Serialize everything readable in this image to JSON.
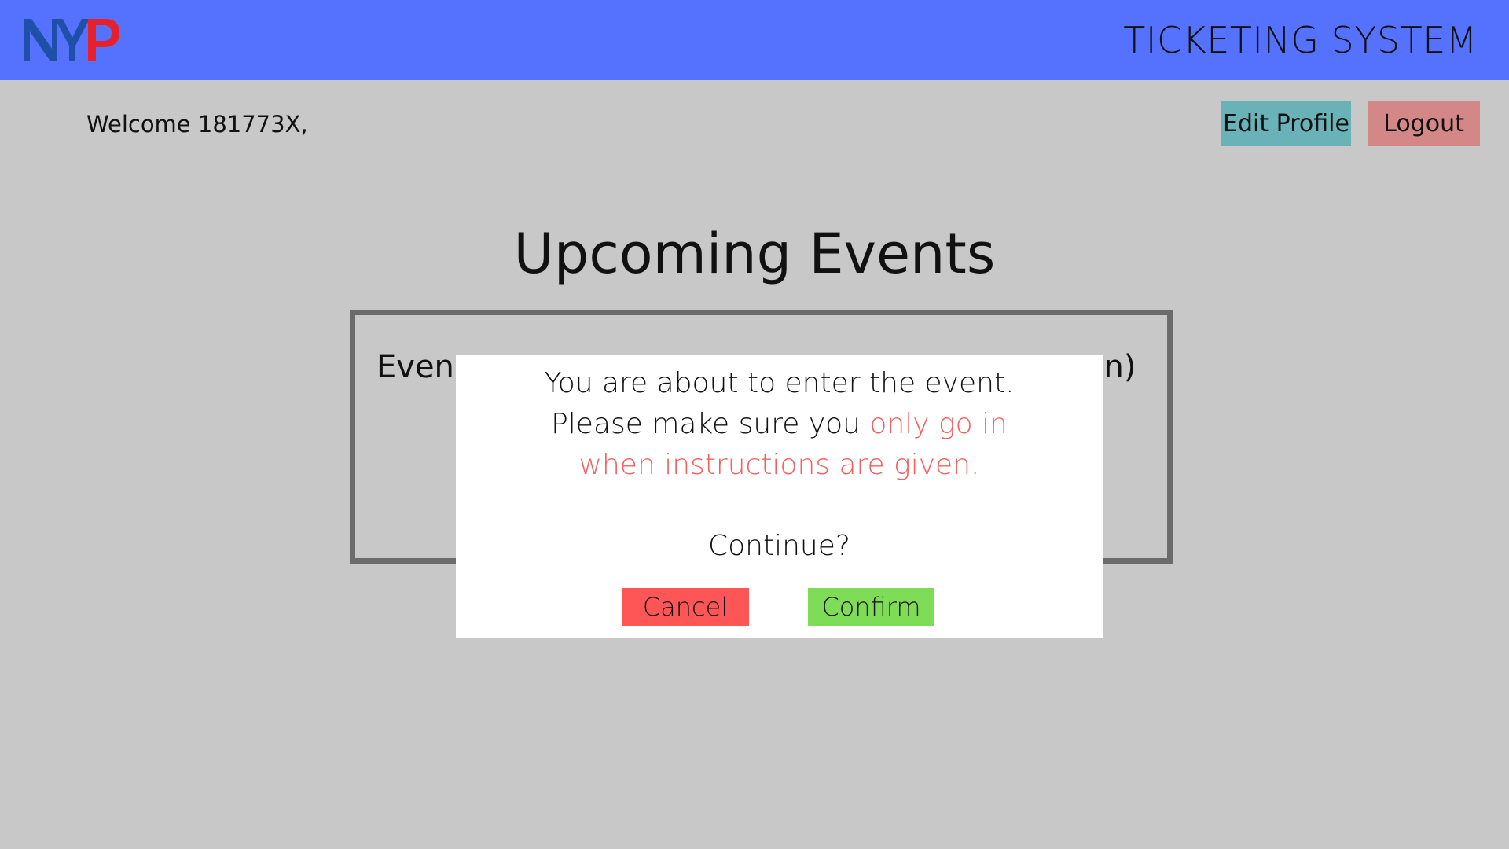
{
  "header": {
    "logo_text": "NYP",
    "app_title": "TICKETING SYSTEM"
  },
  "user": {
    "welcome_text": "Welcome 181773X,"
  },
  "actions": {
    "edit_profile_label": "Edit Profile",
    "logout_label": "Logout"
  },
  "main": {
    "title": "Upcoming Events",
    "event_card": {
      "text_left_visible": "Event",
      "text_right_visible": "on)"
    }
  },
  "dialog": {
    "line1": "You are about to enter the event.",
    "line2_prefix": "Please make sure you ",
    "line2_highlight": "only go in",
    "line3_highlight": "when instructions are given.",
    "question": "Continue?",
    "cancel_label": "Cancel",
    "confirm_label": "Confirm"
  },
  "colors": {
    "header_bg": "#5472fe",
    "page_bg": "#c8c8c8",
    "edit_profile_bg": "#68b2b8",
    "logout_bg": "#d48787",
    "highlight_text": "#f45f5f",
    "cancel_bg": "#fe5656",
    "confirm_bg": "#7edc56",
    "logo_blue": "#1f4fa8",
    "logo_red": "#e8202a"
  }
}
